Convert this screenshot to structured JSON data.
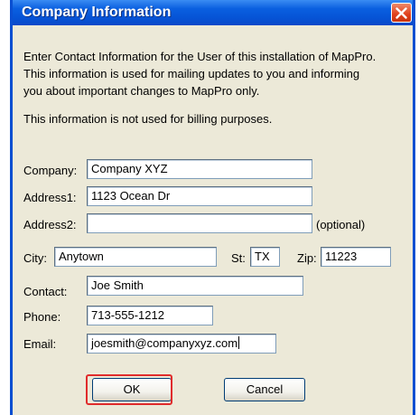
{
  "window": {
    "title": "Company Information",
    "close_icon": "close-icon"
  },
  "intro": {
    "line1": "Enter Contact Information for the User of this installation of MapPro.",
    "line2": "This information is used for mailing updates to you and informing",
    "line3": "you about important changes to MapPro only.",
    "note": "This information is not used for billing purposes."
  },
  "form": {
    "company": {
      "label": "Company:",
      "value": "Company XYZ"
    },
    "address1": {
      "label": "Address1:",
      "value": "1123 Ocean Dr"
    },
    "address2": {
      "label": "Address2:",
      "value": "",
      "hint": "(optional)"
    },
    "city": {
      "label": "City:",
      "value": "Anytown"
    },
    "state": {
      "label": "St:",
      "value": "TX"
    },
    "zip": {
      "label": "Zip:",
      "value": "11223"
    },
    "contact": {
      "label": "Contact:",
      "value": "Joe Smith"
    },
    "phone": {
      "label": "Phone:",
      "value": "713-555-1212"
    },
    "email": {
      "label": "Email:",
      "value": "joesmith@companyxyz.com"
    }
  },
  "buttons": {
    "ok": "OK",
    "cancel": "Cancel"
  },
  "colors": {
    "titlebar": "#0a5fe0",
    "dialog_bg": "#ece9d8",
    "highlight": "#e02c2c"
  }
}
